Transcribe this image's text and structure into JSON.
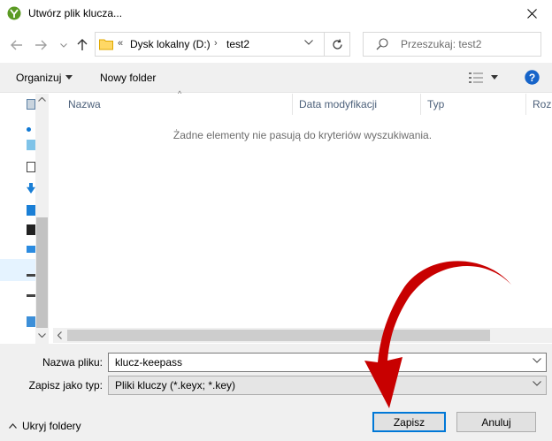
{
  "window": {
    "title": "Utwórz plik klucza..."
  },
  "address": {
    "overflow": "«",
    "crumbs": [
      "Dysk lokalny (D:)",
      "test2"
    ],
    "separator": "›"
  },
  "search": {
    "placeholder": "Przeszukaj: test2"
  },
  "toolbar": {
    "organize_label": "Organizuj",
    "new_folder_label": "Nowy folder"
  },
  "columns": [
    "Nazwa",
    "Data modyfikacji",
    "Typ",
    "Rozm"
  ],
  "empty_message": "Żadne elementy nie pasują do kryteriów wyszukiwania.",
  "filename": {
    "label": "Nazwa pliku:",
    "value": "klucz-keepass"
  },
  "filetype": {
    "label": "Zapisz jako typ:",
    "value": "Pliki kluczy (*.keyx; *.key)"
  },
  "hide_folders_label": "Ukryj foldery",
  "buttons": {
    "save": "Zapisz",
    "cancel": "Anuluj"
  },
  "colors": {
    "accent": "#0078d7",
    "arrow": "#d40000",
    "help": "#1664c9"
  }
}
